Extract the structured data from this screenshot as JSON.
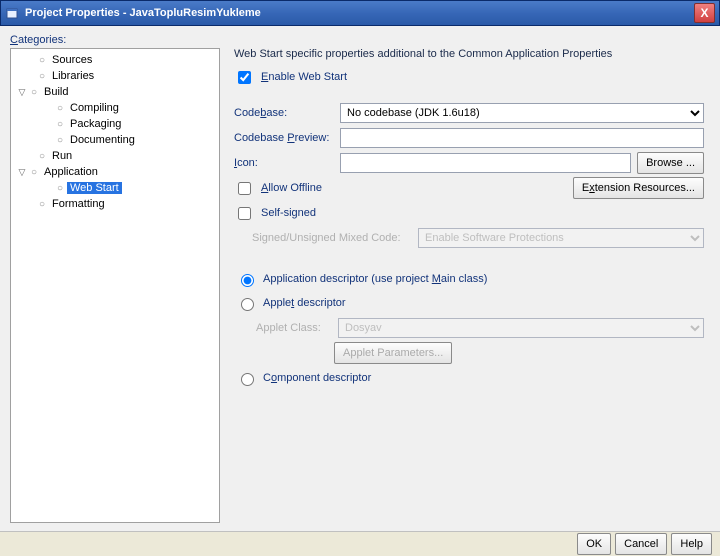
{
  "window": {
    "title": "Project Properties - JavaTopluResimYukleme",
    "close_x": "X"
  },
  "sidebar": {
    "heading": "Categories:",
    "nodes": [
      {
        "label": "Sources",
        "level": 1,
        "leaf": true,
        "name": "tree-sources"
      },
      {
        "label": "Libraries",
        "level": 1,
        "leaf": true,
        "name": "tree-libraries"
      },
      {
        "label": "Build",
        "level": 0,
        "leaf": false,
        "name": "tree-build"
      },
      {
        "label": "Compiling",
        "level": 2,
        "leaf": true,
        "name": "tree-compiling"
      },
      {
        "label": "Packaging",
        "level": 2,
        "leaf": true,
        "name": "tree-packaging"
      },
      {
        "label": "Documenting",
        "level": 2,
        "leaf": true,
        "name": "tree-documenting"
      },
      {
        "label": "Run",
        "level": 1,
        "leaf": true,
        "name": "tree-run"
      },
      {
        "label": "Application",
        "level": 0,
        "leaf": false,
        "name": "tree-application"
      },
      {
        "label": "Web Start",
        "level": 2,
        "leaf": true,
        "name": "tree-webstart",
        "selected": true
      },
      {
        "label": "Formatting",
        "level": 1,
        "leaf": true,
        "name": "tree-formatting"
      }
    ]
  },
  "form": {
    "intro": "Web Start specific properties additional to the Common Application Properties",
    "enable_label": "Enable Web Start",
    "enable_checked": true,
    "codebase_label": "Codebase:",
    "codebase_value": "No codebase (JDK 1.6u18)",
    "codebase_preview_label": "Codebase Preview:",
    "codebase_preview_value": "",
    "icon_label": "Icon:",
    "icon_value": "",
    "browse_label": "Browse ...",
    "allow_offline_label": "Allow Offline",
    "ext_res_label": "Extension Resources...",
    "self_signed_label": "Self-signed",
    "mixed_code_label": "Signed/Unsigned Mixed Code:",
    "mixed_code_value": "Enable Software Protections",
    "desc_app_label": "Application descriptor (use project Main class)",
    "desc_applet_label": "Applet descriptor",
    "applet_class_label": "Applet Class:",
    "applet_class_value": "Dosyav",
    "applet_params_label": "Applet Parameters...",
    "desc_component_label": "Component descriptor"
  },
  "buttons": {
    "ok": "OK",
    "cancel": "Cancel",
    "help": "Help"
  }
}
